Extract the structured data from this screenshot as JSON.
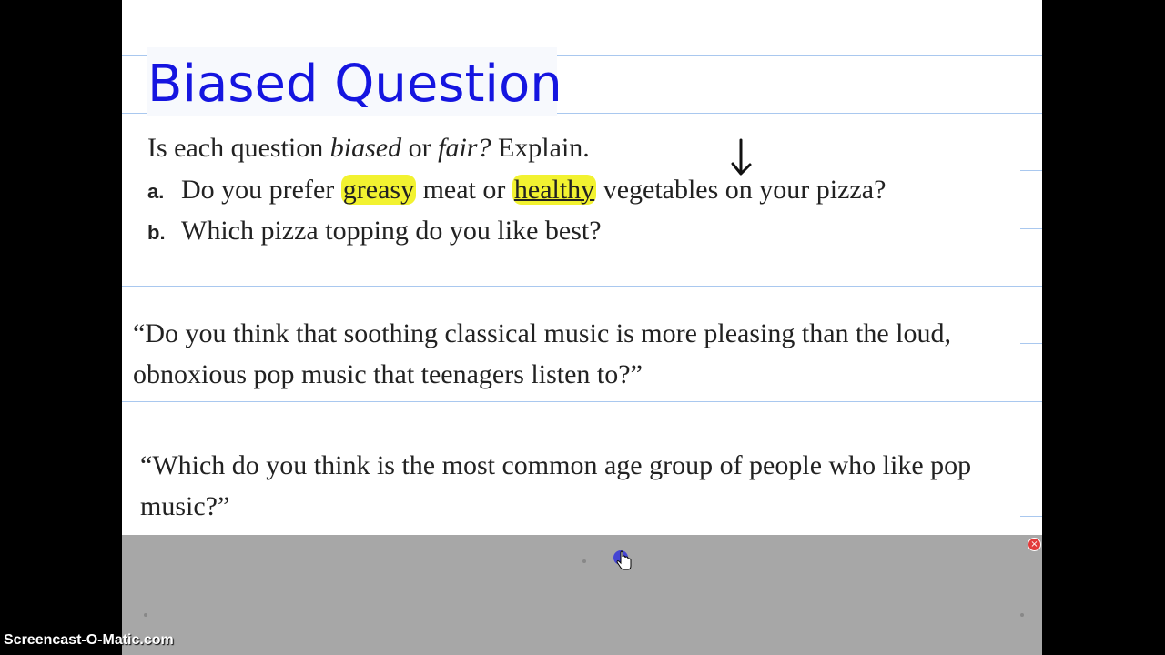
{
  "slide": {
    "title": "Biased Question",
    "prompt": {
      "start": "Is each question ",
      "biased": "biased",
      "or": " or ",
      "fair": "fair?",
      "end": " Explain."
    },
    "question_a": {
      "letter": "a.",
      "pre": "Do you prefer ",
      "hl1": "greasy",
      "mid": " meat or ",
      "hl2": "healthy",
      "post": " vegetables on your pizza?"
    },
    "question_b": {
      "letter": "b.",
      "text": "Which pizza topping do you like best?"
    },
    "quote1": "“Do you think that soothing classical music is more pleasing than the loud, obnoxious pop music that teenagers listen to?”",
    "quote2": "“Which do you think is the most common age group of people who like pop music?”"
  },
  "watermark": "Screencast-O-Matic.com",
  "toolbar": {
    "close_label": "×"
  },
  "icons": {
    "arrow": "down-arrow-annotation",
    "cursor": "hand-pointer-icon",
    "close": "close-icon"
  },
  "colors": {
    "title": "#1515e0",
    "highlight": "#f2f230",
    "rule": "#a9c8ef",
    "toolbar": "#a7a7a7"
  }
}
